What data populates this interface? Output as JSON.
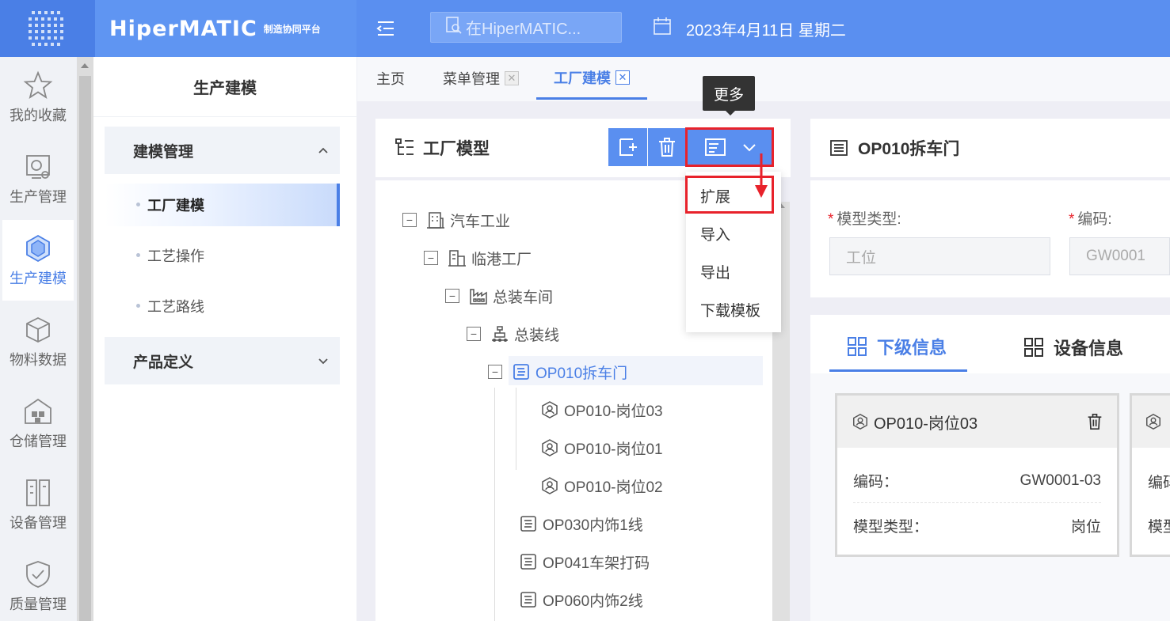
{
  "header": {
    "brand_name": "HiperMATIC",
    "brand_sub": "制造协同平台",
    "search_placeholder": "在HiperMATIC...",
    "date": "2023年4月11日 星期二"
  },
  "rail": {
    "items": [
      {
        "label": "我的收藏",
        "icon": "star-icon"
      },
      {
        "label": "生产管理",
        "icon": "production-icon"
      },
      {
        "label": "生产建模",
        "icon": "cube-icon"
      },
      {
        "label": "物料数据",
        "icon": "box-icon"
      },
      {
        "label": "仓储管理",
        "icon": "warehouse-icon"
      },
      {
        "label": "设备管理",
        "icon": "device-icon"
      },
      {
        "label": "质量管理",
        "icon": "shield-icon"
      }
    ]
  },
  "submenu": {
    "title": "生产建模",
    "group1": "建模管理",
    "items": [
      "工厂建模",
      "工艺操作",
      "工艺路线"
    ],
    "group2": "产品定义"
  },
  "tabs": [
    {
      "label": "主页"
    },
    {
      "label": "菜单管理"
    },
    {
      "label": "工厂建模"
    }
  ],
  "tree_panel": {
    "title": "工厂模型",
    "tooltip": "更多",
    "dropdown": [
      "扩展",
      "导入",
      "导出",
      "下载模板"
    ],
    "nodes": [
      {
        "label": "汽车工业",
        "icon": "building-icon"
      },
      {
        "label": "临港工厂",
        "icon": "factory-icon"
      },
      {
        "label": "总装车间",
        "icon": "workshop-icon"
      },
      {
        "label": "总装线",
        "icon": "line-icon"
      },
      {
        "label": "OP010拆车门",
        "icon": "process-icon"
      },
      {
        "label": "OP010-岗位03",
        "icon": "station-icon"
      },
      {
        "label": "OP010-岗位01",
        "icon": "station-icon"
      },
      {
        "label": "OP010-岗位02",
        "icon": "station-icon"
      },
      {
        "label": "OP030内饰1线",
        "icon": "process-icon"
      },
      {
        "label": "OP041车架打码",
        "icon": "process-icon"
      },
      {
        "label": "OP060内饰2线",
        "icon": "process-icon"
      }
    ]
  },
  "detail": {
    "title": "OP010拆车门",
    "model_type_label": "模型类型:",
    "model_type_value": "工位",
    "code_label": "编码:",
    "code_value": "GW0001",
    "tab1": "下级信息",
    "tab2": "设备信息",
    "card": {
      "title": "OP010-岗位03",
      "code_label": "编码：",
      "code_value": "GW0001-03",
      "type_label": "模型类型：",
      "type_value": "岗位"
    },
    "card2_code_label": "编码",
    "card2_type_label": "模型"
  },
  "colors": {
    "primary": "#5a8ff0",
    "highlight": "#e8222b"
  }
}
